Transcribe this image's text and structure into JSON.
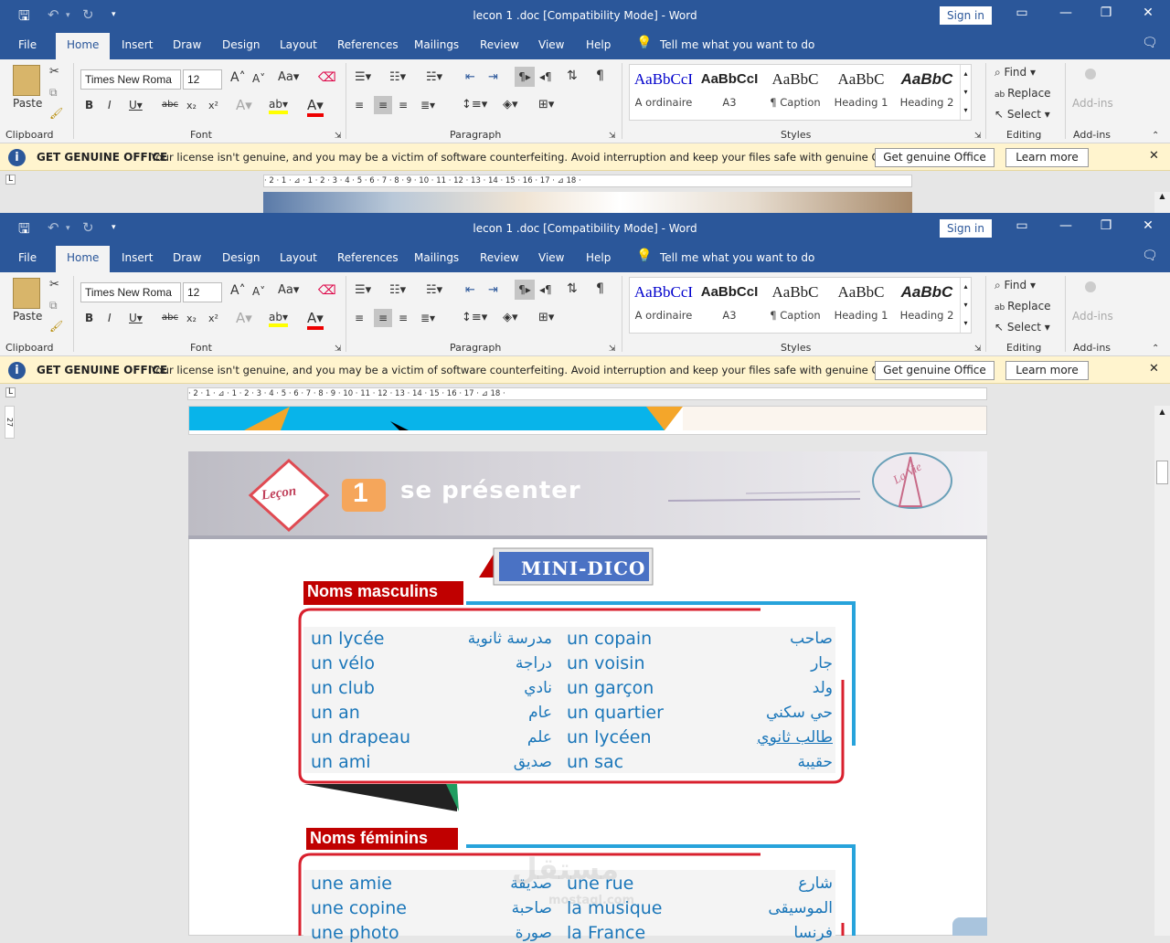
{
  "window": {
    "title": "lecon 1 .doc [Compatibility Mode]  -  Word",
    "sign_in": "Sign in"
  },
  "menu": {
    "file": "File",
    "tabs": [
      "Home",
      "Insert",
      "Draw",
      "Design",
      "Layout",
      "References",
      "Mailings",
      "Review",
      "View",
      "Help"
    ],
    "tell_me": "Tell me what you want to do"
  },
  "ribbon": {
    "paste": "Paste",
    "clipboard": "Clipboard",
    "font_name": "Times New Roma",
    "font_size": "12",
    "font": "Font",
    "paragraph": "Paragraph",
    "styles": "Styles",
    "style_items": [
      {
        "preview": "AaBbCcI",
        "name": "A ordinaire",
        "color": "#0000cc"
      },
      {
        "preview": "AaBbCcI",
        "name": "A3",
        "color": "#000000"
      },
      {
        "preview": "AaBbC",
        "name": "¶ Caption",
        "color": "#000000"
      },
      {
        "preview": "AaBbC",
        "name": "Heading 1",
        "color": "#000000"
      },
      {
        "preview": "AaBbC",
        "name": "Heading 2",
        "color": "#000000"
      }
    ],
    "find": "Find",
    "replace": "Replace",
    "select": "Select",
    "editing": "Editing",
    "addins": "Add-ins",
    "addins_group": "Add-ins"
  },
  "warning": {
    "heading": "GET GENUINE OFFICE",
    "message": "Your license isn't genuine, and you may be a victim of software counterfeiting. Avoid interruption and keep your files safe with genuine Office today.",
    "get_button": "Get genuine Office",
    "learn_button": "Learn more"
  },
  "ruler": {
    "marks": "· 2 · 1 · ⊿ · 1 · 2 · 3 · 4 · 5 · 6 · 7 · 8 · 9 · 10 · 11 · 12 · 13 · 14 · 15 · 16 · 17 · ⊿ 18 ·",
    "vertical": "27"
  },
  "document": {
    "lesson_badge": "Leçon",
    "lesson_number": "1",
    "lesson_title": "se présenter",
    "logo_text": "La Vie",
    "mini_dico": "MINI-DICO",
    "masculine_heading": "Noms masculins",
    "masculine": [
      {
        "fr1": "un lycée",
        "ar1": "مدرسة ثانوية",
        "fr2": "un copain",
        "ar2": "صاحب"
      },
      {
        "fr1": "un vélo",
        "ar1": "دراجة",
        "fr2": "un voisin",
        "ar2": "جار"
      },
      {
        "fr1": "un club",
        "ar1": "نادي",
        "fr2": "un garçon",
        "ar2": "ولد"
      },
      {
        "fr1": "un an",
        "ar1": "عام",
        "fr2": "un quartier",
        "ar2": "حي سكني"
      },
      {
        "fr1": "un drapeau",
        "ar1": "علم",
        "fr2": "un lycéen",
        "ar2": "طالب ثانوي"
      },
      {
        "fr1": "un ami",
        "ar1": "صديق",
        "fr2": "un sac",
        "ar2": "حقيبة"
      }
    ],
    "feminine_heading": "Noms féminins",
    "feminine": [
      {
        "fr1": "une amie",
        "ar1": "صديقة",
        "fr2": "une rue",
        "ar2": "شارع"
      },
      {
        "fr1": "une copine",
        "ar1": "صاحبة",
        "fr2": "la musique",
        "ar2": "الموسيقى"
      },
      {
        "fr1": "une photo",
        "ar1": "صورة",
        "fr2": "la France",
        "ar2": "فرنسا"
      }
    ],
    "watermark": "مستقل",
    "watermark_url": "mostaql.com"
  }
}
